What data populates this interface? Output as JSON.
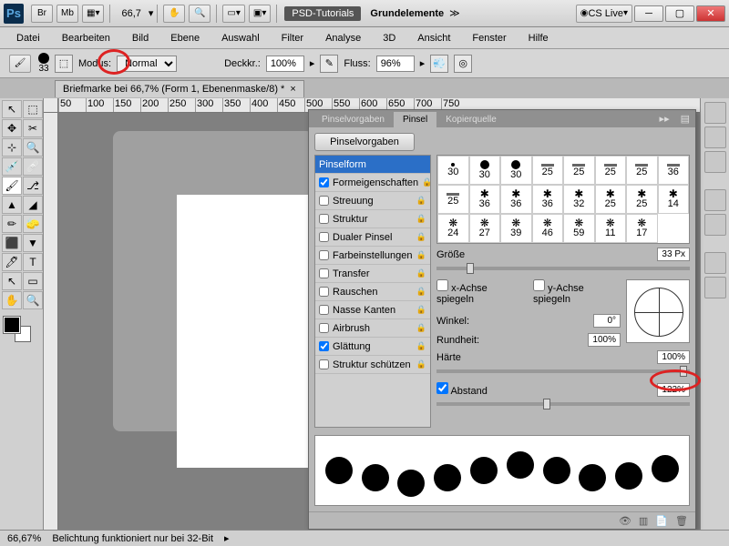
{
  "titlebar": {
    "zoom": "66,7",
    "tag": "PSD-Tutorials",
    "docname": "Grundelemente",
    "cslive": "CS Live"
  },
  "menu": [
    "Datei",
    "Bearbeiten",
    "Bild",
    "Ebene",
    "Auswahl",
    "Filter",
    "Analyse",
    "3D",
    "Ansicht",
    "Fenster",
    "Hilfe"
  ],
  "optbar": {
    "brushnum": "33",
    "mode_label": "Modus:",
    "mode_value": "Normal",
    "opacity_label": "Deckkr.:",
    "opacity_value": "100%",
    "flow_label": "Fluss:",
    "flow_value": "96%"
  },
  "doctab": "Briefmarke bei 66,7% (Form 1, Ebenenmaske/8) *",
  "ruler_marks": [
    "50",
    "100",
    "150",
    "200",
    "250",
    "300",
    "350",
    "400",
    "450",
    "500",
    "550",
    "600",
    "650",
    "700",
    "750"
  ],
  "panel": {
    "tabs": [
      "Pinselvorgaben",
      "Pinsel",
      "Kopierquelle"
    ],
    "active_tab": 1,
    "preset_btn": "Pinselvorgaben",
    "options": [
      {
        "label": "Pinselform",
        "checked": null,
        "selected": true
      },
      {
        "label": "Formeigenschaften",
        "checked": true
      },
      {
        "label": "Streuung",
        "checked": false
      },
      {
        "label": "Struktur",
        "checked": false
      },
      {
        "label": "Dualer Pinsel",
        "checked": false
      },
      {
        "label": "Farbeinstellungen",
        "checked": false
      },
      {
        "label": "Transfer",
        "checked": false
      },
      {
        "label": "Rauschen",
        "checked": false
      },
      {
        "label": "Nasse Kanten",
        "checked": false
      },
      {
        "label": "Airbrush",
        "checked": false
      },
      {
        "label": "Glättung",
        "checked": true
      },
      {
        "label": "Struktur schützen",
        "checked": false
      }
    ],
    "brush_sizes": [
      [
        "30",
        "30",
        "30",
        "25",
        "25",
        "25",
        "25",
        "36"
      ],
      [
        "25",
        "36",
        "36",
        "36",
        "32",
        "25",
        "25",
        "14"
      ],
      [
        "24",
        "27",
        "39",
        "46",
        "59",
        "11",
        "17"
      ]
    ],
    "size_label": "Größe",
    "size_value": "33 Px",
    "mirror_x": "x-Achse spiegeln",
    "mirror_y": "y-Achse spiegeln",
    "angle_label": "Winkel:",
    "angle_value": "0°",
    "round_label": "Rundheit:",
    "round_value": "100%",
    "hardness_label": "Härte",
    "hardness_value": "100%",
    "spacing_label": "Abstand",
    "spacing_value": "122%"
  },
  "status": {
    "zoom": "66,67%",
    "msg": "Belichtung funktioniert nur bei 32-Bit"
  }
}
